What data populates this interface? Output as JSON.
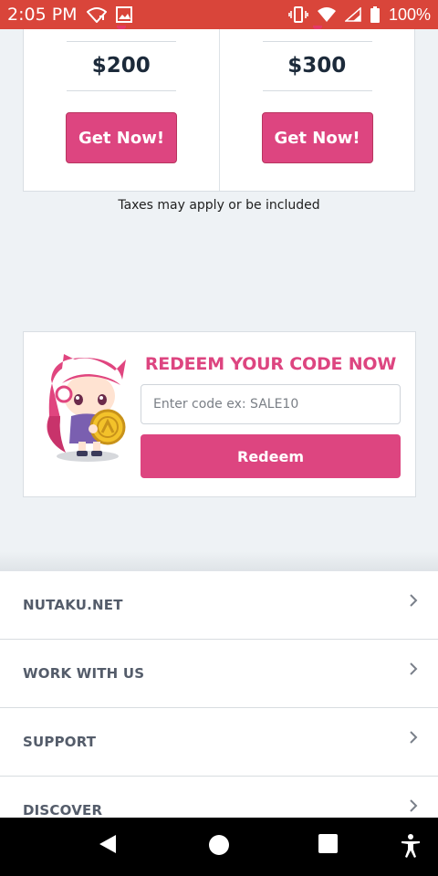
{
  "status_bar": {
    "time": "2:05 PM",
    "battery": "100%",
    "icons": [
      "wifi-calling-icon",
      "photo-icon",
      "vibrate-icon",
      "wifi-icon",
      "signal-icon",
      "battery-icon"
    ]
  },
  "prices": [
    {
      "amount": "$200",
      "button_label": "Get Now!"
    },
    {
      "amount": "$300",
      "button_label": "Get Now!"
    }
  ],
  "tax_note": "Taxes may apply or be included",
  "redeem": {
    "title": "REDEEM YOUR CODE NOW",
    "input_placeholder": "Enter code ex: SALE10",
    "input_value": "",
    "button_label": "Redeem"
  },
  "footer": {
    "items": [
      {
        "label": "NUTAKU.NET"
      },
      {
        "label": "WORK WITH US"
      },
      {
        "label": "SUPPORT"
      },
      {
        "label": "DISCOVER"
      }
    ]
  },
  "colors": {
    "status_bar": "#d9453a",
    "accent": "#dd4580",
    "page_bg": "#eef2f5"
  }
}
